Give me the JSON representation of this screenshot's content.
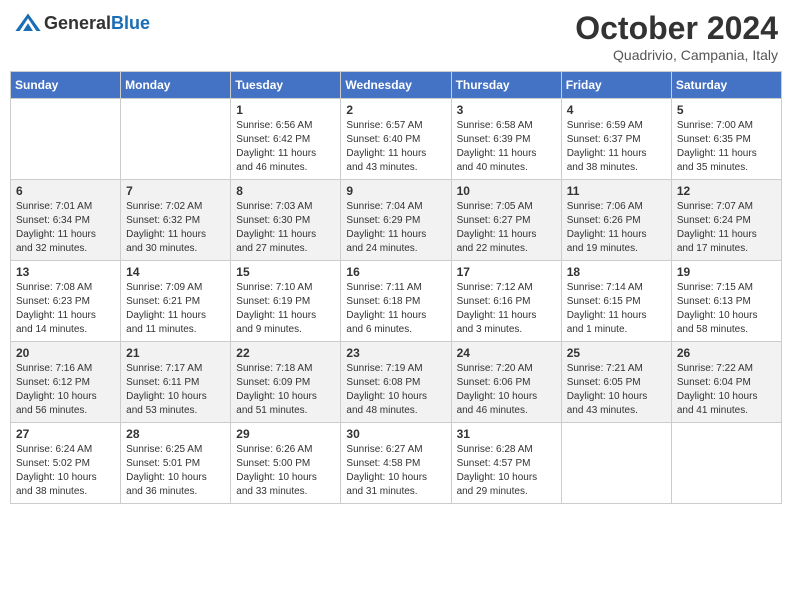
{
  "header": {
    "logo_line1": "General",
    "logo_line2": "Blue",
    "month": "October 2024",
    "location": "Quadrivio, Campania, Italy"
  },
  "weekdays": [
    "Sunday",
    "Monday",
    "Tuesday",
    "Wednesday",
    "Thursday",
    "Friday",
    "Saturday"
  ],
  "weeks": [
    [
      {
        "day": "",
        "info": ""
      },
      {
        "day": "",
        "info": ""
      },
      {
        "day": "1",
        "info": "Sunrise: 6:56 AM\nSunset: 6:42 PM\nDaylight: 11 hours and 46 minutes."
      },
      {
        "day": "2",
        "info": "Sunrise: 6:57 AM\nSunset: 6:40 PM\nDaylight: 11 hours and 43 minutes."
      },
      {
        "day": "3",
        "info": "Sunrise: 6:58 AM\nSunset: 6:39 PM\nDaylight: 11 hours and 40 minutes."
      },
      {
        "day": "4",
        "info": "Sunrise: 6:59 AM\nSunset: 6:37 PM\nDaylight: 11 hours and 38 minutes."
      },
      {
        "day": "5",
        "info": "Sunrise: 7:00 AM\nSunset: 6:35 PM\nDaylight: 11 hours and 35 minutes."
      }
    ],
    [
      {
        "day": "6",
        "info": "Sunrise: 7:01 AM\nSunset: 6:34 PM\nDaylight: 11 hours and 32 minutes."
      },
      {
        "day": "7",
        "info": "Sunrise: 7:02 AM\nSunset: 6:32 PM\nDaylight: 11 hours and 30 minutes."
      },
      {
        "day": "8",
        "info": "Sunrise: 7:03 AM\nSunset: 6:30 PM\nDaylight: 11 hours and 27 minutes."
      },
      {
        "day": "9",
        "info": "Sunrise: 7:04 AM\nSunset: 6:29 PM\nDaylight: 11 hours and 24 minutes."
      },
      {
        "day": "10",
        "info": "Sunrise: 7:05 AM\nSunset: 6:27 PM\nDaylight: 11 hours and 22 minutes."
      },
      {
        "day": "11",
        "info": "Sunrise: 7:06 AM\nSunset: 6:26 PM\nDaylight: 11 hours and 19 minutes."
      },
      {
        "day": "12",
        "info": "Sunrise: 7:07 AM\nSunset: 6:24 PM\nDaylight: 11 hours and 17 minutes."
      }
    ],
    [
      {
        "day": "13",
        "info": "Sunrise: 7:08 AM\nSunset: 6:23 PM\nDaylight: 11 hours and 14 minutes."
      },
      {
        "day": "14",
        "info": "Sunrise: 7:09 AM\nSunset: 6:21 PM\nDaylight: 11 hours and 11 minutes."
      },
      {
        "day": "15",
        "info": "Sunrise: 7:10 AM\nSunset: 6:19 PM\nDaylight: 11 hours and 9 minutes."
      },
      {
        "day": "16",
        "info": "Sunrise: 7:11 AM\nSunset: 6:18 PM\nDaylight: 11 hours and 6 minutes."
      },
      {
        "day": "17",
        "info": "Sunrise: 7:12 AM\nSunset: 6:16 PM\nDaylight: 11 hours and 3 minutes."
      },
      {
        "day": "18",
        "info": "Sunrise: 7:14 AM\nSunset: 6:15 PM\nDaylight: 11 hours and 1 minute."
      },
      {
        "day": "19",
        "info": "Sunrise: 7:15 AM\nSunset: 6:13 PM\nDaylight: 10 hours and 58 minutes."
      }
    ],
    [
      {
        "day": "20",
        "info": "Sunrise: 7:16 AM\nSunset: 6:12 PM\nDaylight: 10 hours and 56 minutes."
      },
      {
        "day": "21",
        "info": "Sunrise: 7:17 AM\nSunset: 6:11 PM\nDaylight: 10 hours and 53 minutes."
      },
      {
        "day": "22",
        "info": "Sunrise: 7:18 AM\nSunset: 6:09 PM\nDaylight: 10 hours and 51 minutes."
      },
      {
        "day": "23",
        "info": "Sunrise: 7:19 AM\nSunset: 6:08 PM\nDaylight: 10 hours and 48 minutes."
      },
      {
        "day": "24",
        "info": "Sunrise: 7:20 AM\nSunset: 6:06 PM\nDaylight: 10 hours and 46 minutes."
      },
      {
        "day": "25",
        "info": "Sunrise: 7:21 AM\nSunset: 6:05 PM\nDaylight: 10 hours and 43 minutes."
      },
      {
        "day": "26",
        "info": "Sunrise: 7:22 AM\nSunset: 6:04 PM\nDaylight: 10 hours and 41 minutes."
      }
    ],
    [
      {
        "day": "27",
        "info": "Sunrise: 6:24 AM\nSunset: 5:02 PM\nDaylight: 10 hours and 38 minutes."
      },
      {
        "day": "28",
        "info": "Sunrise: 6:25 AM\nSunset: 5:01 PM\nDaylight: 10 hours and 36 minutes."
      },
      {
        "day": "29",
        "info": "Sunrise: 6:26 AM\nSunset: 5:00 PM\nDaylight: 10 hours and 33 minutes."
      },
      {
        "day": "30",
        "info": "Sunrise: 6:27 AM\nSunset: 4:58 PM\nDaylight: 10 hours and 31 minutes."
      },
      {
        "day": "31",
        "info": "Sunrise: 6:28 AM\nSunset: 4:57 PM\nDaylight: 10 hours and 29 minutes."
      },
      {
        "day": "",
        "info": ""
      },
      {
        "day": "",
        "info": ""
      }
    ]
  ]
}
